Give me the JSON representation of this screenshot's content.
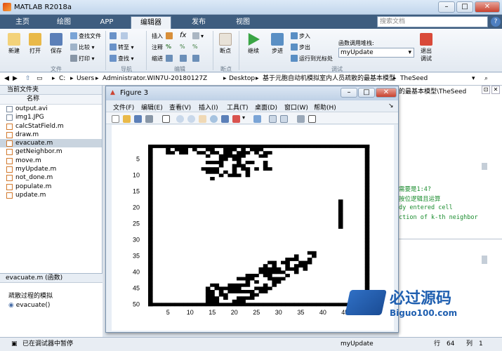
{
  "window": {
    "title": "MATLAB R2018a",
    "min": "–",
    "max": "□",
    "close": "✕"
  },
  "tabs": [
    "主页",
    "绘图",
    "APP",
    "编辑器",
    "发布",
    "视图"
  ],
  "search": {
    "placeholder": "搜索文档"
  },
  "ribbon": {
    "file": {
      "new": "新建",
      "open": "打开",
      "save": "保存",
      "find_files": "查找文件",
      "compare": "比较",
      "print": "打印",
      "group": "文件"
    },
    "nav": {
      "goto": "转至",
      "find": "查找",
      "group": "导航"
    },
    "edit": {
      "insert": "插入",
      "comment": "注释",
      "indent": "缩进",
      "fx": "fx",
      "group": "编辑"
    },
    "breakpoints": {
      "label": "断点",
      "group": "断点"
    },
    "debug": {
      "continue": "继续",
      "step": "步进",
      "step_in": "步入",
      "step_out": "步出",
      "run_to_cursor": "运行到光标处",
      "stack_label": "函数调用堆栈:",
      "stack_value": "myUpdate",
      "quit": "退出",
      "quit2": "调试",
      "group": "调试"
    }
  },
  "address": {
    "path": [
      "C:",
      "Users",
      "Administrator.WIN7U-20180127Z",
      "Desktop",
      "基于元胞自动机模拟室内人员疏散的最基本模型",
      "TheSeed"
    ]
  },
  "left_pane": {
    "title": "当前文件夹",
    "col_name": "名称",
    "files": [
      "output.avi",
      "img1.JPG",
      "calcStatField.m",
      "draw.m",
      "evacuate.m",
      "getNeighbor.m",
      "move.m",
      "myUpdate.m",
      "not_done.m",
      "populate.m",
      "update.m"
    ],
    "selected": "evacuate.m",
    "details_title": "evacuate.m  (函数)",
    "details_desc": "疏散过程的模拟",
    "details_func": "evacuate()"
  },
  "right_pane": {
    "crumb": "的最基本模型\\TheSeed",
    "lines": [
      "需要是1:4?",
      "按位逻辑且运算",
      "dy entered cell",
      "ction of k-th neighbor"
    ]
  },
  "figure": {
    "title": "Figure 3",
    "menu": [
      "文件(F)",
      "编辑(E)",
      "查看(V)",
      "插入(I)",
      "工具(T)",
      "桌面(D)",
      "窗口(W)",
      "帮助(H)"
    ],
    "yticks": [
      "5",
      "10",
      "15",
      "20",
      "25",
      "30",
      "35",
      "40",
      "45",
      "50"
    ],
    "xticks": [
      "5",
      "10",
      "15",
      "20",
      "25",
      "30",
      "35",
      "40",
      "45",
      "50"
    ]
  },
  "watermark": {
    "main": "必过源码",
    "sub": "Biguo100.com"
  },
  "status": {
    "left": "已在调试器中暂停",
    "func": "myUpdate",
    "row_label": "行",
    "row": "64",
    "col_label": "列",
    "col": "1"
  }
}
